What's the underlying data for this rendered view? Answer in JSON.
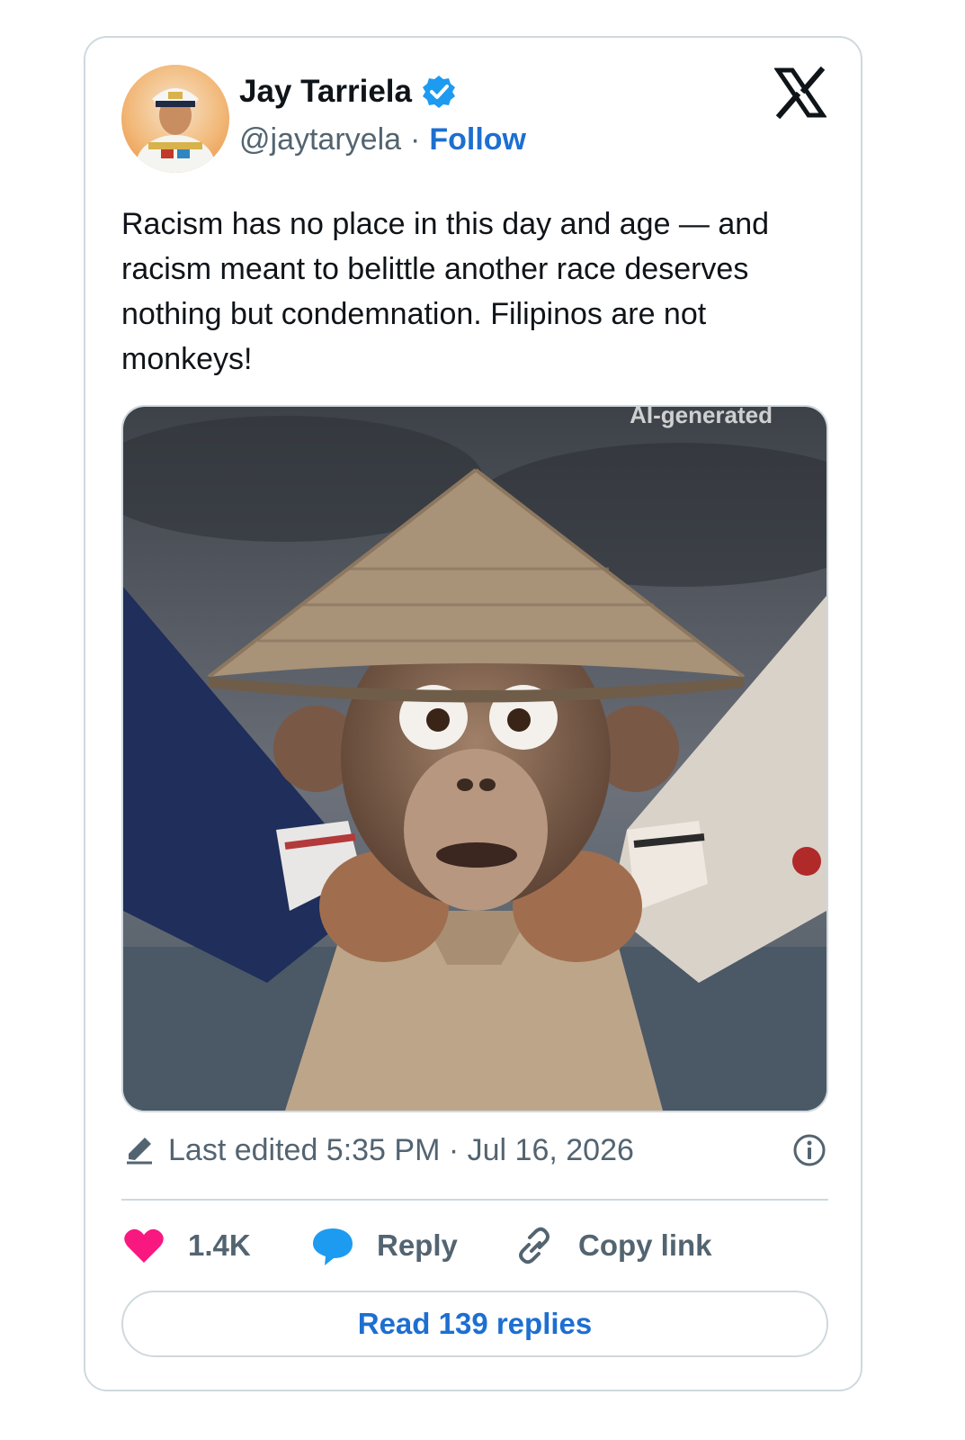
{
  "author": {
    "display_name": "Jay Tarriela",
    "handle": "@jaytaryela",
    "separator": "·",
    "follow_label": "Follow"
  },
  "tweet": {
    "text": "Racism has no place in this day and age — and racism meant to belittle another race deserves nothing but condemnation. Filipinos are not monkeys!",
    "media_watermark": "AI-generated"
  },
  "meta": {
    "edited_text": "Last edited 5:35 PM · Jul 16, 2026"
  },
  "actions": {
    "like_count": "1.4K",
    "reply_label": "Reply",
    "copy_label": "Copy link"
  },
  "footer": {
    "read_replies_label": "Read 139 replies"
  },
  "colors": {
    "accent": "#1d6fd1",
    "verified": "#1d9bf0",
    "like": "#f91880",
    "reply_bubble": "#1d9bf0",
    "muted_text": "#536471",
    "border": "#cfd9de"
  },
  "icons": [
    "verified-badge-icon",
    "x-logo-icon",
    "pencil-icon",
    "info-icon",
    "heart-icon",
    "chat-bubble-icon",
    "link-icon"
  ]
}
